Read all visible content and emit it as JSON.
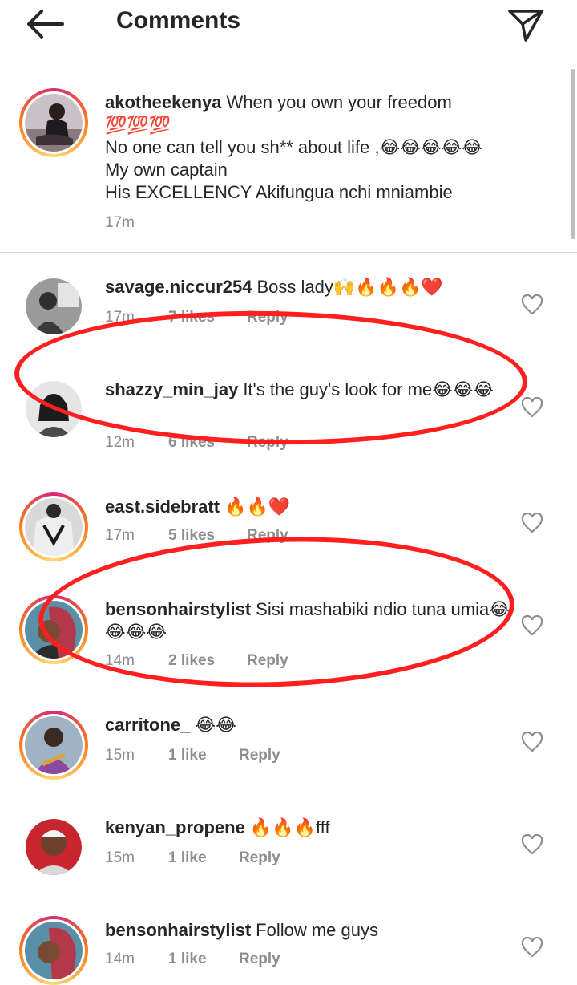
{
  "header": {
    "title": "Comments",
    "back_icon": "arrow-left-icon",
    "send_icon": "paper-plane-icon"
  },
  "caption": {
    "username": "akotheekenya",
    "lines": [
      "When you own your freedom",
      "💯💯💯",
      "No one can tell you sh** about life ,😂😂😂😂😂",
      "My own captain",
      "His EXCELLENCY Akifungua nchi mniambie"
    ],
    "time": "17m"
  },
  "comments": [
    {
      "username": "savage.niccur254",
      "text": "Boss lady🙌🔥🔥🔥❤️",
      "time": "17m",
      "likes": "7 likes",
      "reply": "Reply"
    },
    {
      "username": "shazzy_min_jay",
      "text": "It's the guy's look for me😂😂😂",
      "time": "12m",
      "likes": "6 likes",
      "reply": "Reply"
    },
    {
      "username": "east.sidebratt",
      "text": "🔥🔥❤️",
      "time": "17m",
      "likes": "5 likes",
      "reply": "Reply"
    },
    {
      "username": "bensonhairstylist",
      "text": "Sisi mashabiki ndio tuna umia😂😂😂😂",
      "time": "14m",
      "likes": "2 likes",
      "reply": "Reply"
    },
    {
      "username": "carritone_",
      "text": "😂😂",
      "time": "15m",
      "likes": "1 like",
      "reply": "Reply"
    },
    {
      "username": "kenyan_propene",
      "text": "🔥🔥🔥fff",
      "time": "15m",
      "likes": "1 like",
      "reply": "Reply"
    },
    {
      "username": "bensonhairstylist",
      "text": "Follow me guys",
      "time": "14m",
      "likes": "1 like",
      "reply": "Reply"
    }
  ],
  "colors": {
    "annotation": "#ff1f1f",
    "story_ring": "#d62976",
    "meta_text": "#8e8e8e"
  }
}
